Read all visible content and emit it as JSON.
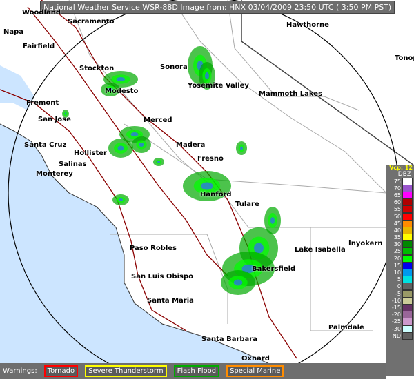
{
  "header": {
    "title": "National Weather Service WSR-88D Image from: HNX 03/04/2009 23:50 UTC ( 3:50 PM PST)"
  },
  "cities": [
    "Woodland",
    "Sacramento",
    "Napa",
    "Fairfield",
    "Hawthorne",
    "Tonopah",
    "Stockton",
    "Sonora",
    "Modesto",
    "Yosemite Valley",
    "Mammoth Lakes",
    "Fremont",
    "San Jose",
    "Merced",
    "Santa Cruz",
    "Hollister",
    "Madera",
    "Salinas",
    "Fresno",
    "Monterey",
    "Hanford",
    "Tulare",
    "Paso Robles",
    "Lake Isabella",
    "Inyokern",
    "Bakersfield",
    "San Luis Obispo",
    "Santa Maria",
    "Palmdale",
    "Santa Barbara",
    "Oxnard"
  ],
  "legend": {
    "vcp": "Vcp: 12",
    "unit": "DBZ",
    "entries": [
      {
        "label": "75",
        "color": "#ffffff"
      },
      {
        "label": "70",
        "color": "#9955cc"
      },
      {
        "label": "65",
        "color": "#ff00ff"
      },
      {
        "label": "60",
        "color": "#b00000"
      },
      {
        "label": "55",
        "color": "#d00000"
      },
      {
        "label": "50",
        "color": "#ff0000"
      },
      {
        "label": "45",
        "color": "#ff8c00"
      },
      {
        "label": "40",
        "color": "#e8b800"
      },
      {
        "label": "35",
        "color": "#ffff00"
      },
      {
        "label": "30",
        "color": "#008800"
      },
      {
        "label": "25",
        "color": "#00bb00"
      },
      {
        "label": "20",
        "color": "#00ff00"
      },
      {
        "label": "15",
        "color": "#0000ee"
      },
      {
        "label": "10",
        "color": "#0099ee"
      },
      {
        "label": "5",
        "color": "#00e0e0"
      },
      {
        "label": "0",
        "color": "#606060"
      },
      {
        "label": "-5",
        "color": "#999966"
      },
      {
        "label": "-10",
        "color": "#cccc99"
      },
      {
        "label": "-15",
        "color": "#663366"
      },
      {
        "label": "-20",
        "color": "#996699"
      },
      {
        "label": "-25",
        "color": "#cc99cc"
      },
      {
        "label": "-30",
        "color": "#ccffff"
      },
      {
        "label": "ND",
        "color": "#606060"
      }
    ]
  },
  "warnings": {
    "label": "Warnings:",
    "items": [
      {
        "label": "Tornado",
        "color": "#ff0000"
      },
      {
        "label": "Severe Thunderstorm",
        "color": "#ffff00"
      },
      {
        "label": "Flash Flood",
        "color": "#00aa00"
      },
      {
        "label": "Special Marine",
        "color": "#ff8c00"
      }
    ]
  }
}
